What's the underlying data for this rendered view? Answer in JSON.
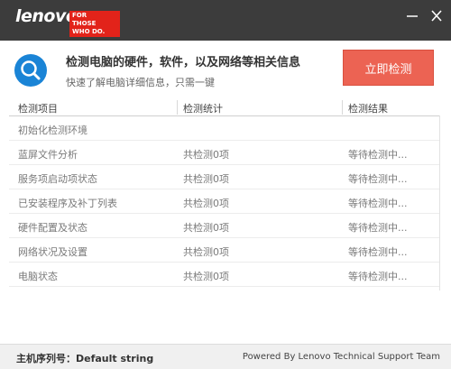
{
  "titlebar": {
    "logo_word": "lenovo",
    "logo_tag_line1": "FOR",
    "logo_tag_line2": "THOSE",
    "logo_tag_line3": "WHO DO.",
    "minimize_icon": "minimize-icon",
    "close_icon": "close-icon"
  },
  "header": {
    "icon": "search-icon",
    "headline": "检测电脑的硬件，软件，以及网络等相关信息",
    "subline": "快速了解电脑详细信息，只需一键",
    "start_button": "立即检测",
    "accent_color": "#ec6353",
    "icon_color": "#1a84d6"
  },
  "table": {
    "columns": [
      "检测项目",
      "检测统计",
      "检测结果"
    ],
    "rows": [
      {
        "item": "初始化检测环境",
        "stat": "",
        "result": ""
      },
      {
        "item": "蓝屏文件分析",
        "stat": "共检测0项",
        "result": "等待检测中..."
      },
      {
        "item": "服务项启动项状态",
        "stat": "共检测0项",
        "result": "等待检测中..."
      },
      {
        "item": "已安装程序及补丁列表",
        "stat": "共检测0项",
        "result": "等待检测中..."
      },
      {
        "item": "硬件配置及状态",
        "stat": "共检测0项",
        "result": "等待检测中..."
      },
      {
        "item": "网络状况及设置",
        "stat": "共检测0项",
        "result": "等待检测中..."
      },
      {
        "item": "电脑状态",
        "stat": "共检测0项",
        "result": "等待检测中..."
      }
    ]
  },
  "footer": {
    "serial": "主机序列号：Default string",
    "powered": "Powered By Lenovo Technical Support Team"
  }
}
